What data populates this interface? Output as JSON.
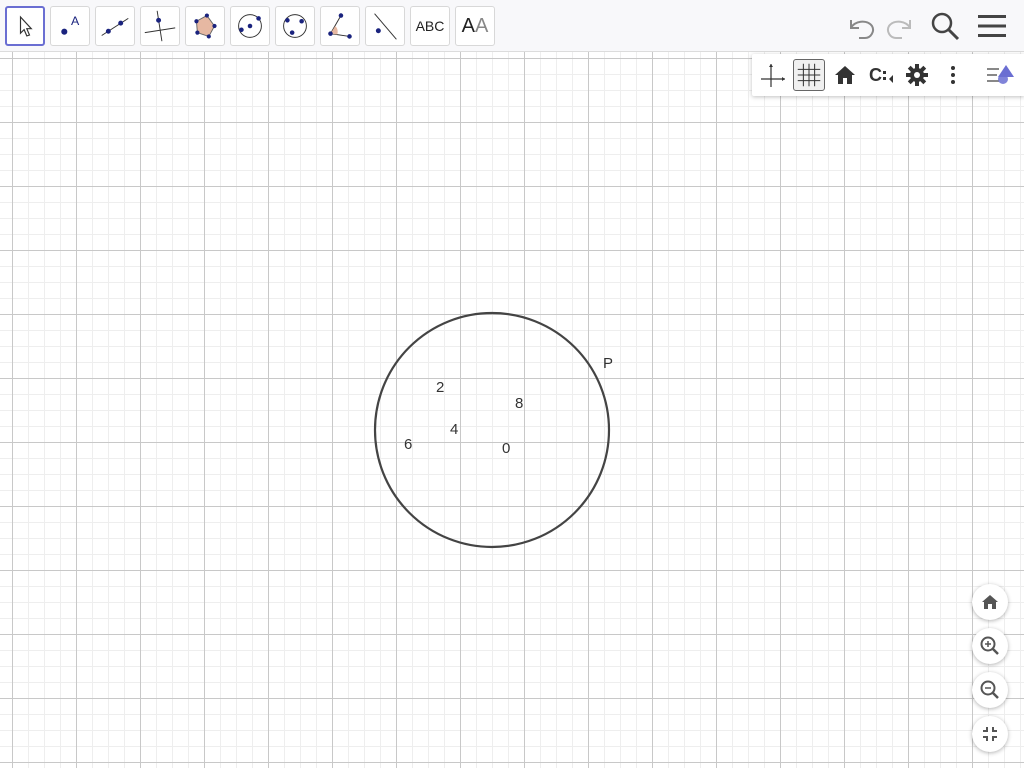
{
  "toolbar": {
    "tools": [
      {
        "name": "move-tool",
        "label": ""
      },
      {
        "name": "point-tool",
        "label": "A"
      },
      {
        "name": "line-tool",
        "label": ""
      },
      {
        "name": "perpendicular-line-tool",
        "label": ""
      },
      {
        "name": "polygon-tool",
        "label": ""
      },
      {
        "name": "circle-center-point-tool",
        "label": ""
      },
      {
        "name": "circle-three-points-tool",
        "label": ""
      },
      {
        "name": "angle-tool",
        "label": ""
      },
      {
        "name": "reflect-tool",
        "label": ""
      },
      {
        "name": "text-tool",
        "label": "ABC"
      },
      {
        "name": "style-tool",
        "label_a": "A",
        "label_b": "A"
      }
    ],
    "selected_tool": "move-tool"
  },
  "icons": {
    "undo": "undo-icon",
    "redo": "redo-icon",
    "search": "search-icon",
    "menu": "menu-icon"
  },
  "stylebar": {
    "buttons": [
      "axes-toggle",
      "grid-toggle",
      "standard-view",
      "point-capturing",
      "graphics-settings",
      "more-options",
      "algebra-toggle"
    ],
    "grid_active": true,
    "point_capturing_label": "C"
  },
  "canvas": {
    "grid": true,
    "circle": {
      "stroke": "#444444"
    },
    "labels": {
      "p": "P",
      "n0": "0",
      "n2": "2",
      "n4": "4",
      "n6": "6",
      "n8": "8"
    }
  },
  "zoom_buttons": [
    "standard-view-home",
    "zoom-in",
    "zoom-out",
    "fullscreen"
  ],
  "colors": {
    "accent": "#6a6ed2",
    "point_blue": "#1a237e",
    "toolbar_bg": "#f8f8fa"
  }
}
